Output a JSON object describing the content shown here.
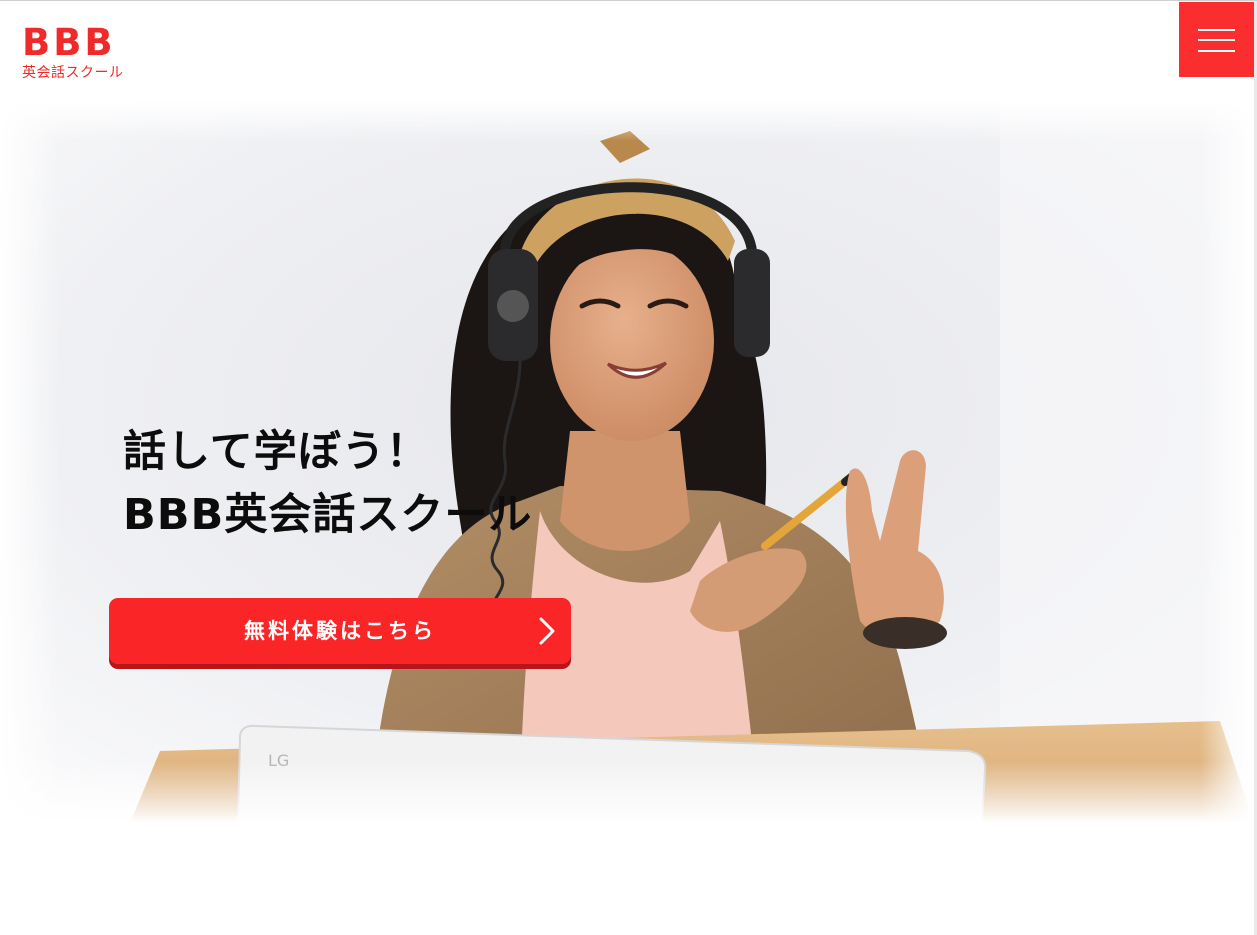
{
  "header": {
    "logo": {
      "mark": "BBB",
      "subtitle": "英会話スクール"
    },
    "menu_button_icon": "hamburger-menu-icon"
  },
  "hero": {
    "image_description_icon": "photo",
    "heading_line1": "話して学ぼう！",
    "heading_line2": "BBB英会話スクール",
    "cta_label": "無料体験はこちら",
    "cta_icon": "chevron-right-icon",
    "laptop_brand": "LG"
  },
  "colors": {
    "brand_red": "#ee2a2a",
    "cta_red": "#fa2526",
    "cta_shadow": "#b8151b",
    "heading_text": "#0c0c0c"
  }
}
